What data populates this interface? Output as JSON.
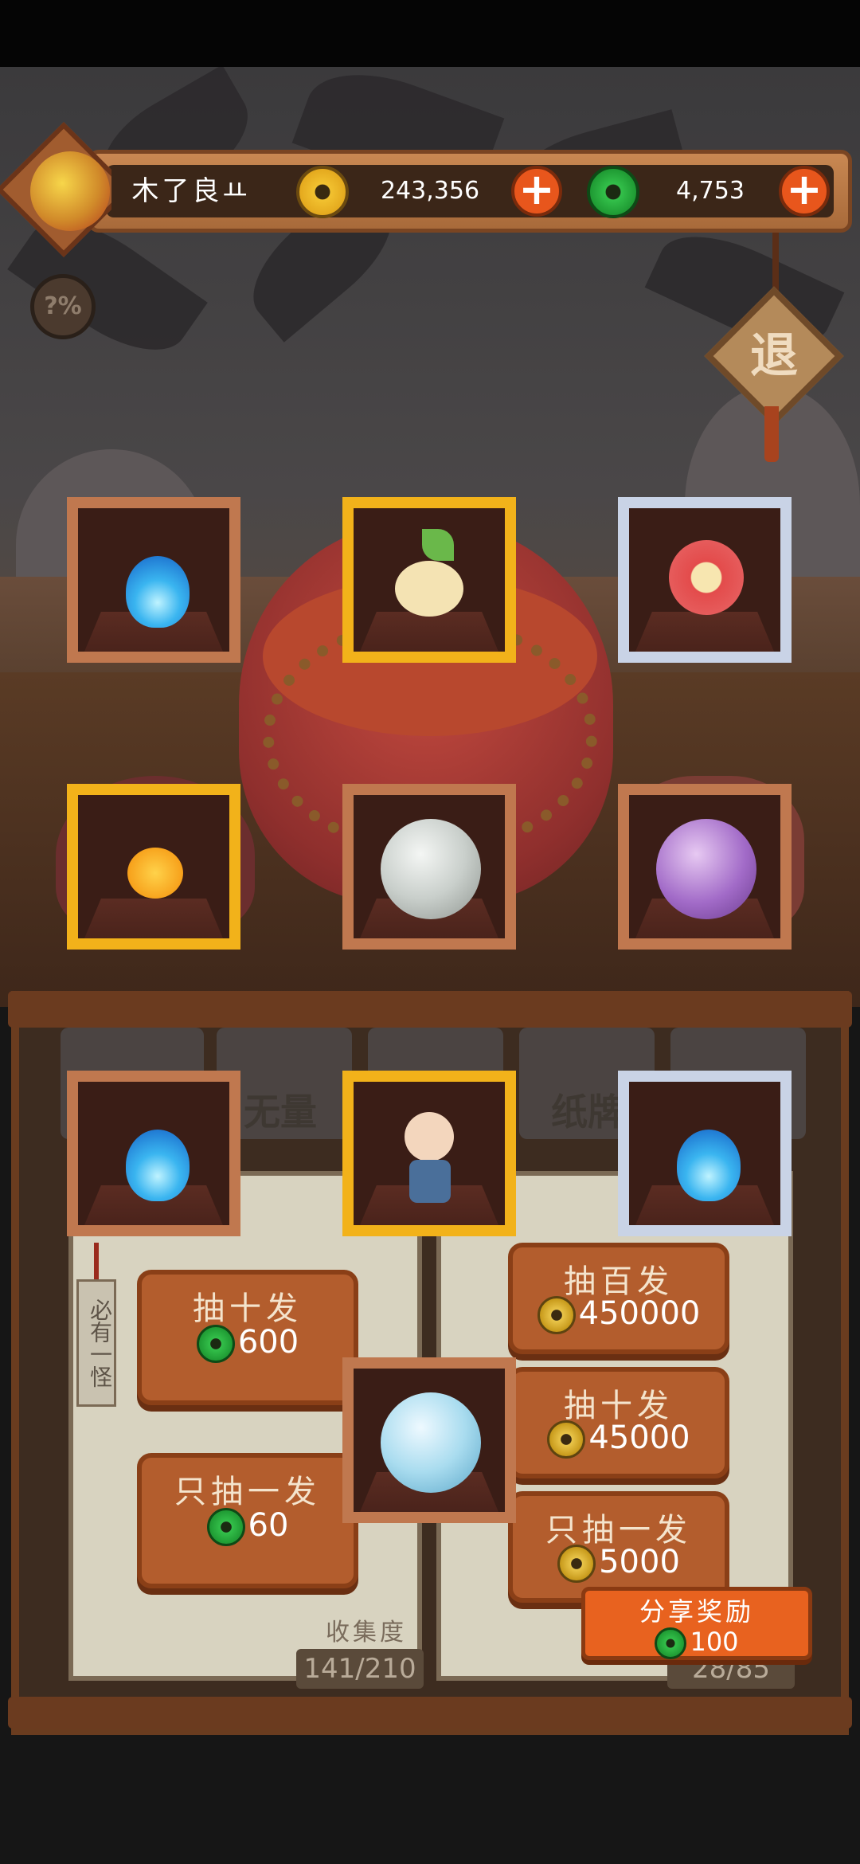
{
  "player": {
    "name": "木了良",
    "name_suffix": "ㅛ",
    "gold": "243,356",
    "jade": "4,753"
  },
  "buttons": {
    "exit_label": "退",
    "rate_label": "?%"
  },
  "tabs": [
    {
      "label": "无量"
    },
    {
      "label": "纸牌"
    }
  ],
  "tag_text": "必有一怪",
  "left_draws": [
    {
      "title": "抽十发",
      "currency": "jade",
      "cost": "600"
    },
    {
      "title": "只抽一发",
      "currency": "jade",
      "cost": "60"
    }
  ],
  "right_draws": [
    {
      "title": "抽百发",
      "currency": "gold",
      "cost": "450000"
    },
    {
      "title": "抽十发",
      "currency": "gold",
      "cost": "45000"
    },
    {
      "title": "只抽一发",
      "currency": "gold",
      "cost": "5000"
    }
  ],
  "collection": {
    "label": "收集度",
    "left_value": "141/210",
    "right_value": "28/85"
  },
  "share": {
    "label": "分享奖励",
    "reward": "100"
  },
  "reward_items": [
    {
      "name": "blue-flame",
      "rarity": "bronze"
    },
    {
      "name": "leaf-sprout-spirit",
      "rarity": "gold"
    },
    {
      "name": "plum-blossom-spirit",
      "rarity": "silver"
    },
    {
      "name": "fire-spirit",
      "rarity": "gold"
    },
    {
      "name": "tornado-orb",
      "rarity": "bronze"
    },
    {
      "name": "purple-mushroom-orb",
      "rarity": "bronze"
    },
    {
      "name": "blue-flame",
      "rarity": "bronze"
    },
    {
      "name": "boy-character",
      "rarity": "gold"
    },
    {
      "name": "blue-flame",
      "rarity": "silver"
    },
    {
      "name": "snowflake-orb",
      "rarity": "bronze"
    }
  ],
  "colors": {
    "bronze_frame": "#c0784f",
    "gold_frame": "#f2b21a",
    "silver_frame": "#c9d3e6",
    "button_orange": "#e8621f"
  }
}
